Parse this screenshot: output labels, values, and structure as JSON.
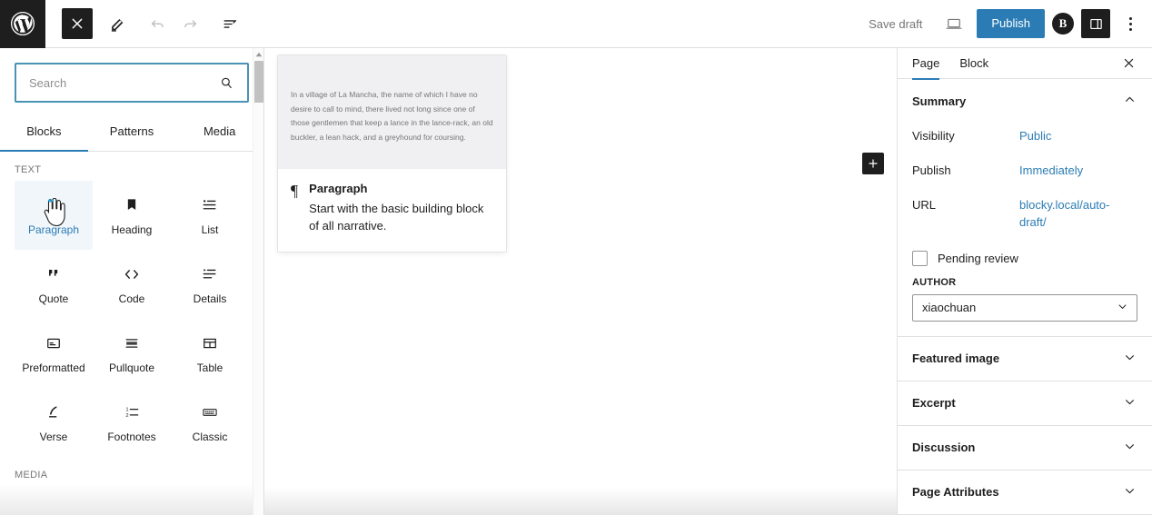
{
  "header": {
    "logo_name": "wordpress-logo",
    "close_label": "Close",
    "edit_label": "Edit",
    "undo_label": "Undo",
    "redo_label": "Redo",
    "list_view_label": "Document Overview",
    "save_draft_label": "Save draft",
    "preview_label": "Preview",
    "publish_label": "Publish",
    "jetpack_label": "B",
    "settings_toggle_label": "Settings",
    "options_label": "Options",
    "publish_color": "#2b7cb5"
  },
  "inserter": {
    "search": {
      "value": "",
      "placeholder": "Search"
    },
    "tabs": [
      {
        "label": "Blocks",
        "active": true
      },
      {
        "label": "Patterns",
        "active": false
      },
      {
        "label": "Media",
        "active": false
      }
    ],
    "groups": [
      {
        "label": "TEXT",
        "blocks": [
          {
            "label": "Paragraph",
            "icon": "paragraph-icon",
            "selected": true
          },
          {
            "label": "Heading",
            "icon": "heading-icon",
            "selected": false
          },
          {
            "label": "List",
            "icon": "list-icon",
            "selected": false
          },
          {
            "label": "Quote",
            "icon": "quote-icon",
            "selected": false
          },
          {
            "label": "Code",
            "icon": "code-icon",
            "selected": false
          },
          {
            "label": "Details",
            "icon": "details-icon",
            "selected": false
          },
          {
            "label": "Preformatted",
            "icon": "preformatted-icon",
            "selected": false
          },
          {
            "label": "Pullquote",
            "icon": "pullquote-icon",
            "selected": false
          },
          {
            "label": "Table",
            "icon": "table-icon",
            "selected": false
          },
          {
            "label": "Verse",
            "icon": "verse-icon",
            "selected": false
          },
          {
            "label": "Footnotes",
            "icon": "footnotes-icon",
            "selected": false
          },
          {
            "label": "Classic",
            "icon": "classic-icon",
            "selected": false
          }
        ]
      },
      {
        "label": "MEDIA",
        "blocks": []
      }
    ]
  },
  "canvas": {
    "preview": {
      "sample_text": "In a village of La Mancha, the name of which I have no desire to call to mind, there lived not long since one of those gentlemen that keep a lance in the lance-rack, an old buckler, a lean hack, and a greyhound for coursing.",
      "block_icon": "¶",
      "block_title": "Paragraph",
      "block_description": "Start with the basic building block of all narrative."
    },
    "add_block_label": "+"
  },
  "settings": {
    "tabs": [
      {
        "label": "Page",
        "active": true
      },
      {
        "label": "Block",
        "active": false
      }
    ],
    "close_label": "Close Settings",
    "summary": {
      "title": "Summary",
      "expanded": true,
      "rows": [
        {
          "label": "Visibility",
          "value": "Public"
        },
        {
          "label": "Publish",
          "value": "Immediately"
        },
        {
          "label": "URL",
          "value": "blocky.local/auto-draft/"
        }
      ],
      "pending_review_label": "Pending review",
      "pending_review_checked": false,
      "author_label": "AUTHOR",
      "author_value": "xiaochuan"
    },
    "panels": [
      {
        "title": "Featured image",
        "expanded": false
      },
      {
        "title": "Excerpt",
        "expanded": false
      },
      {
        "title": "Discussion",
        "expanded": false
      },
      {
        "title": "Page Attributes",
        "expanded": false
      }
    ],
    "link_color": "#2b7cb5"
  }
}
